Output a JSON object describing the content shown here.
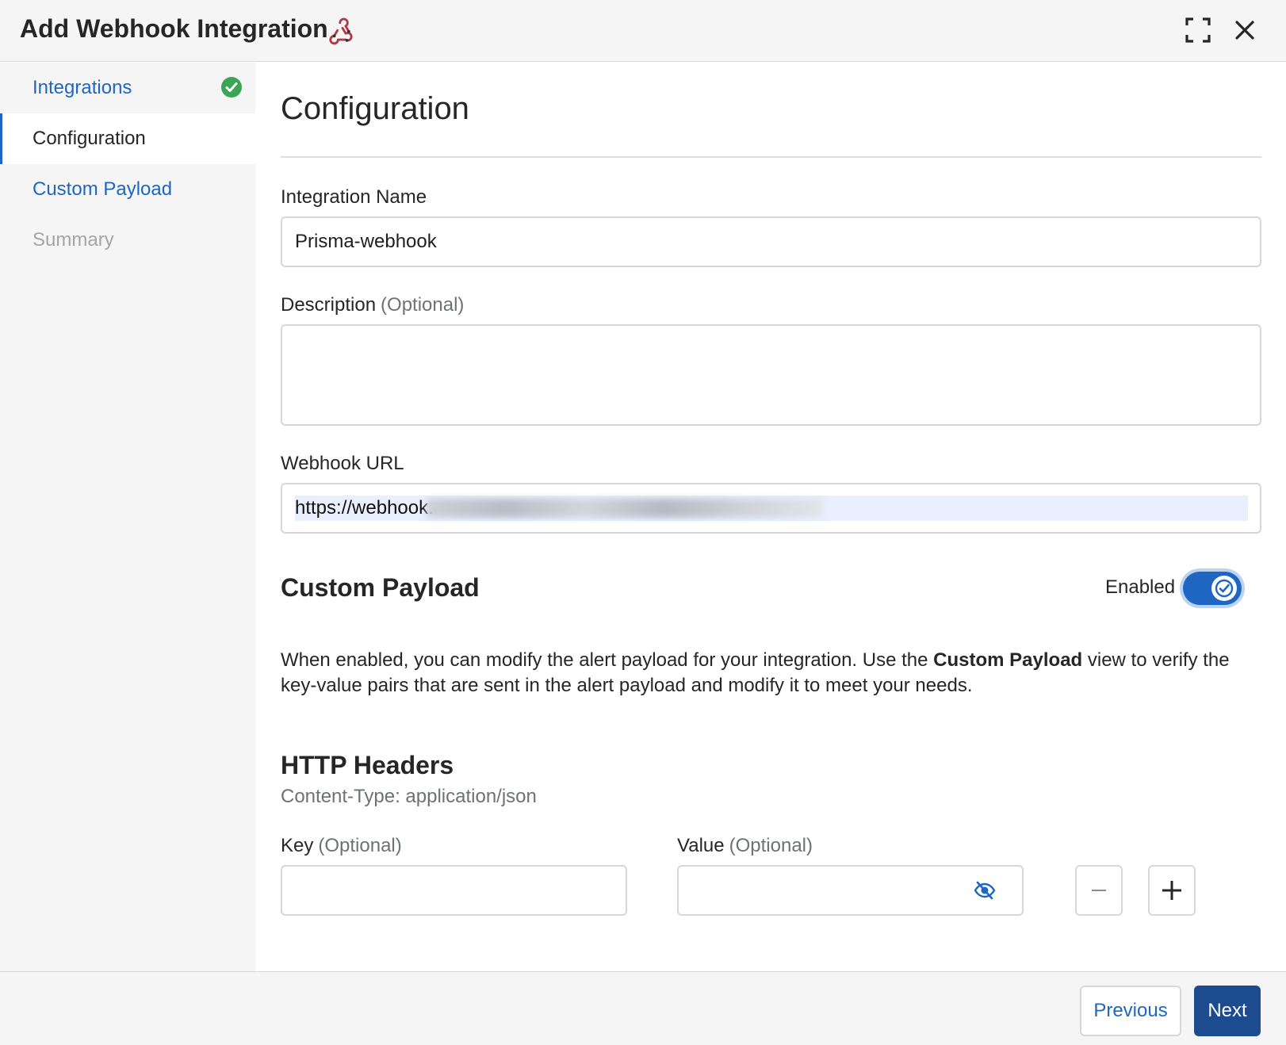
{
  "header": {
    "title": "Add Webhook Integration",
    "icon": "webhook-icon",
    "actions": [
      "expand-icon",
      "close-icon"
    ]
  },
  "sidebar": {
    "steps": [
      {
        "label": "Integrations",
        "state": "completed",
        "icon": "check-circle-icon"
      },
      {
        "label": "Configuration",
        "state": "active"
      },
      {
        "label": "Custom Payload",
        "state": "link"
      },
      {
        "label": "Summary",
        "state": "disabled"
      }
    ]
  },
  "main": {
    "title": "Configuration",
    "integration_name": {
      "label": "Integration Name",
      "value": "Prisma-webhook"
    },
    "description": {
      "label": "Description",
      "optional": "(Optional)",
      "value": ""
    },
    "webhook_url": {
      "label": "Webhook URL",
      "value": "https://webhook."
    },
    "custom_payload": {
      "title": "Custom Payload",
      "toggle_label": "Enabled",
      "enabled": true,
      "desc_prefix": "When enabled, you can modify the alert payload for your integration. Use the ",
      "desc_bold": "Custom Payload",
      "desc_suffix": " view to verify the key-value pairs that are sent in the alert payload and modify it to meet your needs."
    },
    "http_headers": {
      "title": "HTTP Headers",
      "content_type": "Content-Type: application/json",
      "key_label": "Key",
      "key_optional": "(Optional)",
      "key_value": "",
      "value_label": "Value",
      "value_optional": "(Optional)",
      "value_value": ""
    }
  },
  "footer": {
    "previous_label": "Previous",
    "next_label": "Next"
  },
  "colors": {
    "accent": "#1f66c2",
    "primary_button": "#1d4b8f",
    "success": "#3aa655",
    "webhook_icon": "#b23a48"
  }
}
